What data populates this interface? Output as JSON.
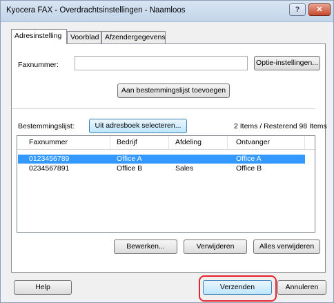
{
  "window": {
    "title": "Kyocera FAX - Overdrachtsinstellingen - Naamloos",
    "help_glyph": "?",
    "close_glyph": "✕"
  },
  "tabs": [
    {
      "label": "Adresinstelling",
      "active": true
    },
    {
      "label": "Voorblad",
      "active": false
    },
    {
      "label": "Afzendergegevens",
      "active": false
    }
  ],
  "address": {
    "fax_label": "Faxnummer:",
    "fax_value": "",
    "options_button": "Optie-instellingen...",
    "add_button": "Aan bestemmingslijst toevoegen",
    "destination_label": "Bestemmingslijst:",
    "addressbook_button": "Uit adresboek selecteren...",
    "count_text": "2 Items / Resterend 98 Items"
  },
  "list": {
    "columns": [
      "Faxnummer",
      "Bedrijf",
      "Afdeling",
      "Ontvanger"
    ],
    "rows": [
      {
        "fax": "0123456789",
        "company": "Office A",
        "department": "",
        "recipient": "Office A",
        "selected": true
      },
      {
        "fax": "0234567891",
        "company": "Office B",
        "department": "Sales",
        "recipient": "Office B",
        "selected": false
      }
    ]
  },
  "list_actions": {
    "edit": "Bewerken...",
    "delete": "Verwijderen",
    "delete_all": "Alles verwijderen"
  },
  "footer": {
    "help": "Help",
    "send": "Verzenden",
    "cancel": "Annuleren"
  },
  "colors": {
    "selection": "#3399ff",
    "highlight_ring": "#e8222a"
  }
}
